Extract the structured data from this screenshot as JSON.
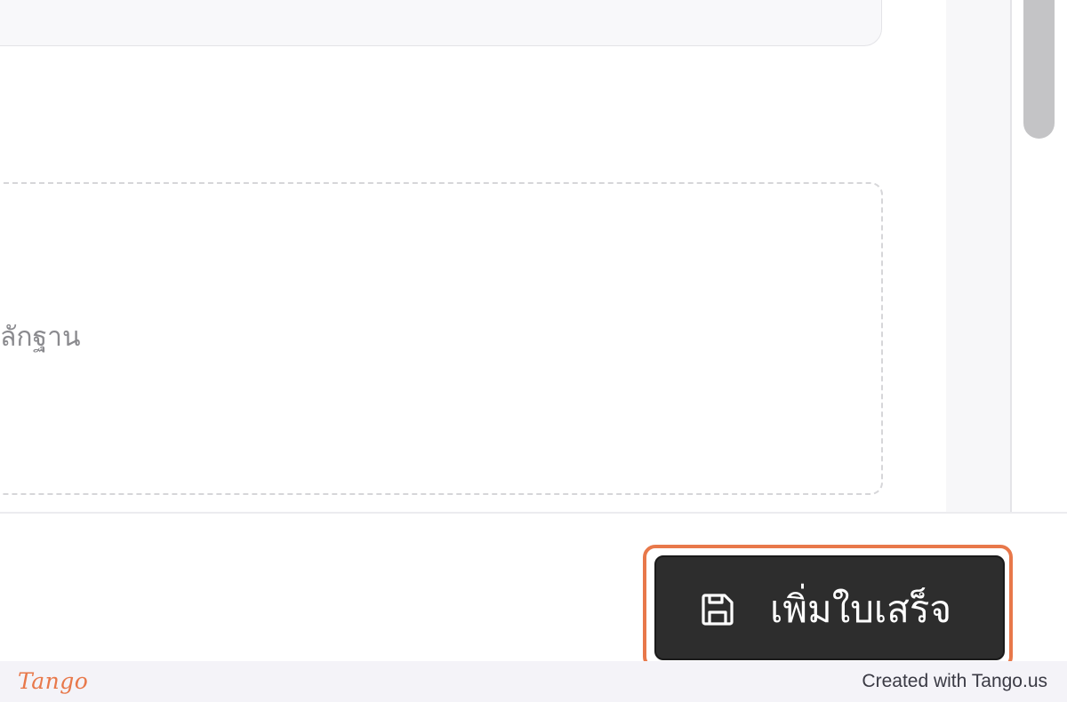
{
  "upload": {
    "hint_text": "ลักฐาน"
  },
  "footer": {
    "save_button_label": "เพิ่มใบเสร็จ",
    "save_icon": "floppy-disk-icon"
  },
  "tango": {
    "logo_text": "Tango",
    "credit_text": "Created with Tango.us",
    "accent_color": "#e8784a"
  },
  "colors": {
    "button_background": "#2d2d2d",
    "button_text": "#ffffff",
    "highlight": "#e8784a"
  }
}
